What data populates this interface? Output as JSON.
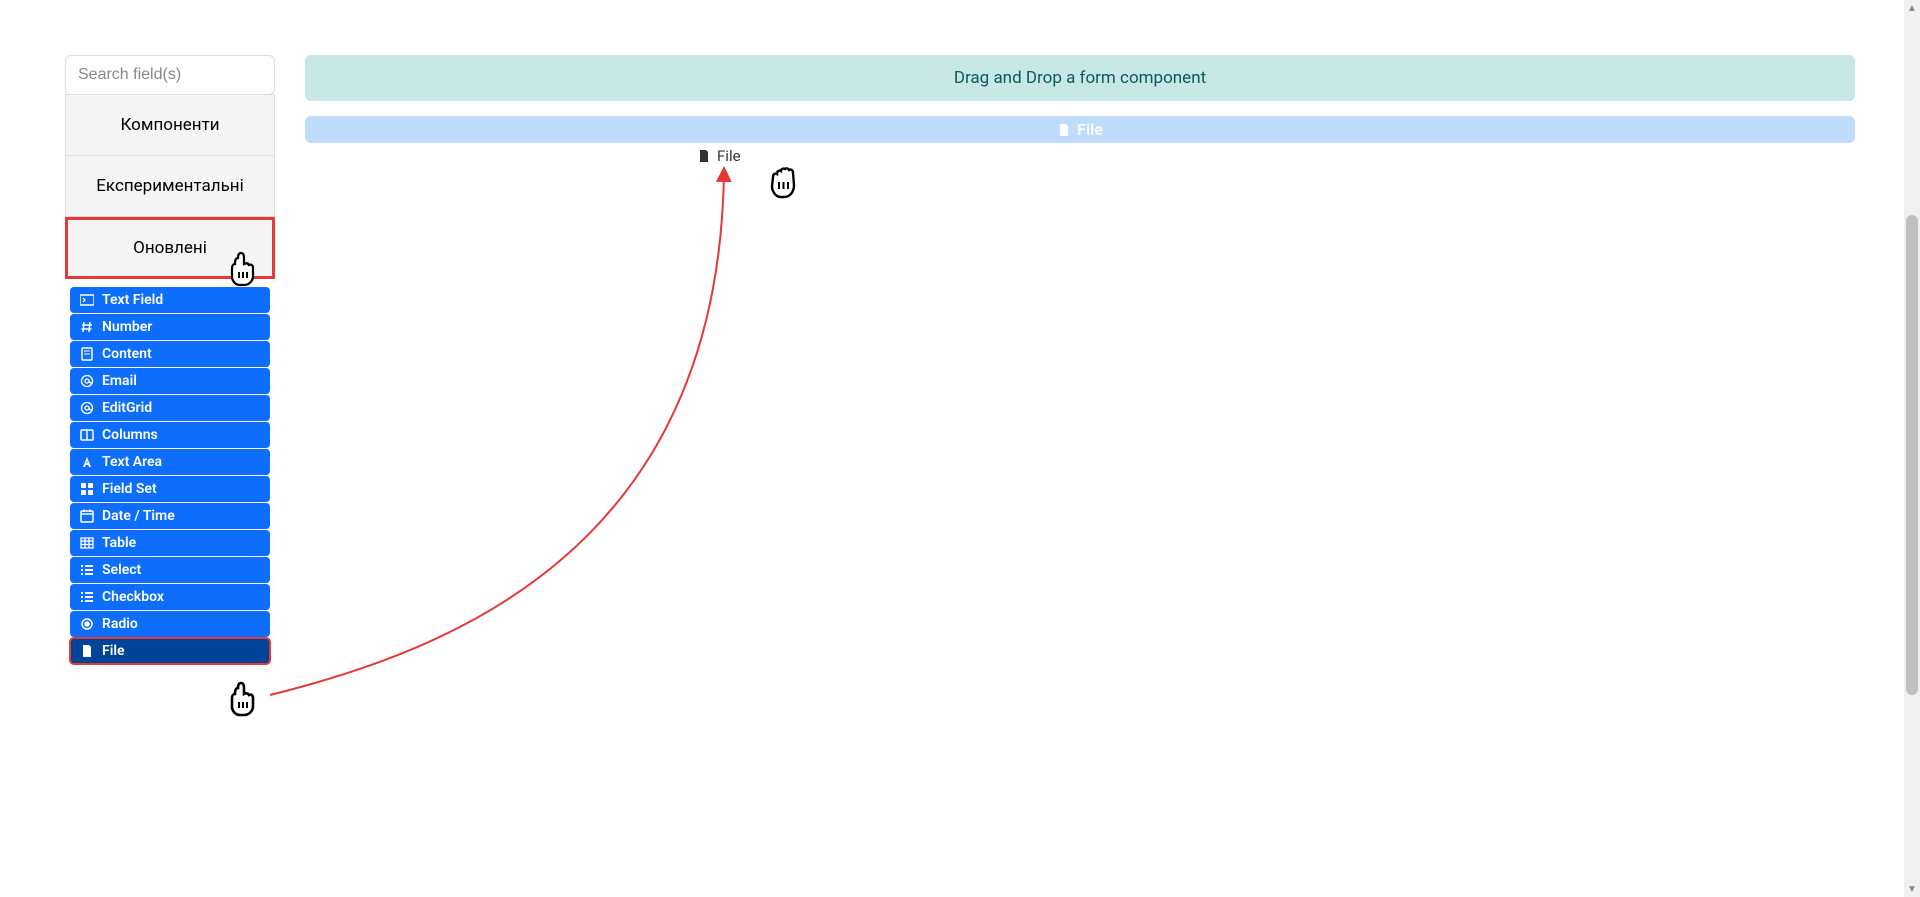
{
  "search": {
    "placeholder": "Search field(s)"
  },
  "categories": {
    "components": "Компоненти",
    "experimental": "Експериментальні",
    "updated": "Оновлені"
  },
  "components": [
    {
      "label": "Text Field",
      "icon": "terminal"
    },
    {
      "label": "Number",
      "icon": "hash"
    },
    {
      "label": "Content",
      "icon": "page"
    },
    {
      "label": "Email",
      "icon": "at"
    },
    {
      "label": "EditGrid",
      "icon": "at"
    },
    {
      "label": "Columns",
      "icon": "columns"
    },
    {
      "label": "Text Area",
      "icon": "font"
    },
    {
      "label": "Field Set",
      "icon": "grid"
    },
    {
      "label": "Date / Time",
      "icon": "calendar"
    },
    {
      "label": "Table",
      "icon": "table"
    },
    {
      "label": "Select",
      "icon": "list"
    },
    {
      "label": "Checkbox",
      "icon": "check"
    },
    {
      "label": "Radio",
      "icon": "radio"
    },
    {
      "label": "File",
      "icon": "file"
    }
  ],
  "dropzone": {
    "text": "Drag and Drop a form component"
  },
  "dropTarget": {
    "label": "File"
  },
  "dragGhost": {
    "label": "File"
  }
}
